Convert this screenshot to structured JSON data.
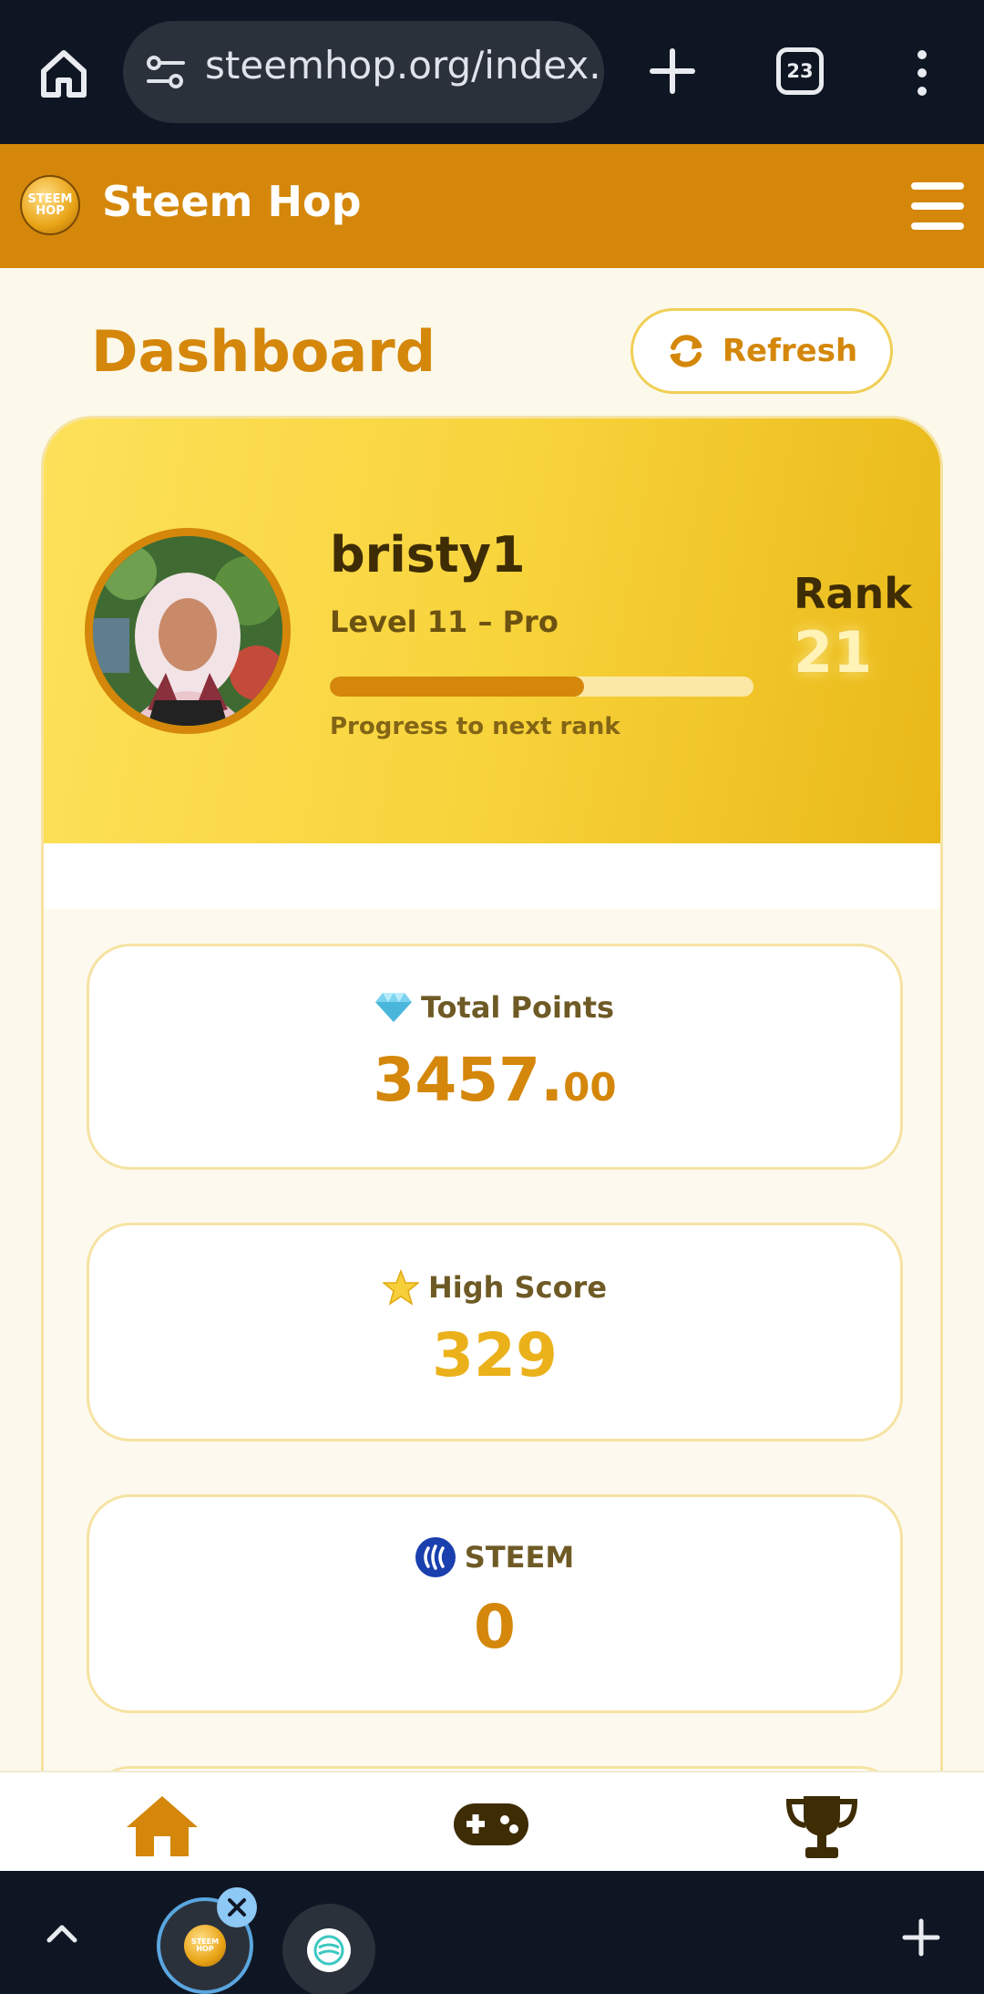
{
  "browser": {
    "url": "steemhop.org/index.",
    "tab_count": "23"
  },
  "app": {
    "title": "Steem Hop",
    "logo_text": "STEEM HOP"
  },
  "dashboard": {
    "title": "Dashboard",
    "refresh_label": "Refresh"
  },
  "profile": {
    "username": "bristy1",
    "level": "Level 11 – Pro",
    "progress_fraction": 0.6,
    "progress_label": "Progress to next rank",
    "rank_label": "Rank",
    "rank_value": "21"
  },
  "stats": [
    {
      "label": "Total Points",
      "value_main": "3457.",
      "value_decimal": "00",
      "icon": "diamond-icon"
    },
    {
      "label": "High Score",
      "value_main": "329",
      "icon": "star-icon"
    },
    {
      "label": "STEEM",
      "value_main": "0",
      "icon": "steem-icon"
    }
  ],
  "nav": [
    "home-icon",
    "gamepad-icon",
    "trophy-icon"
  ],
  "colors": {
    "brand_orange": "#d4870a",
    "brand_yellow": "#fde15a",
    "chrome_dark": "#0f1623",
    "page_bg": "#fcf8ea"
  }
}
